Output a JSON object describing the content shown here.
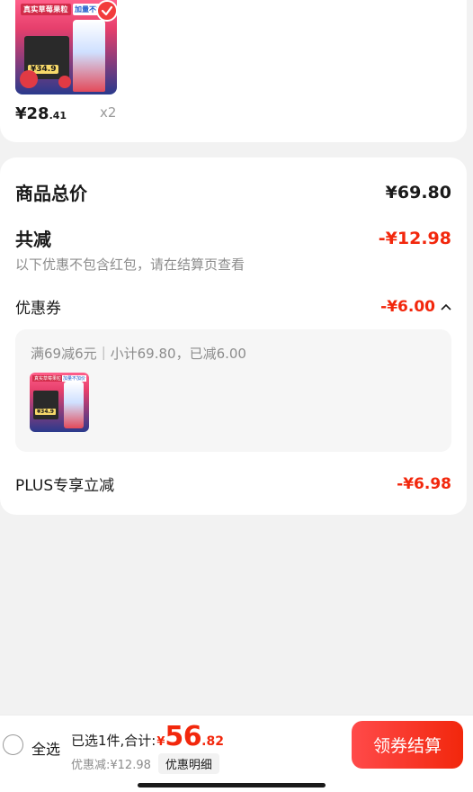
{
  "product": {
    "image_tag_left": "真实草莓果粒",
    "image_tag_right": "加量不加价",
    "image_price_tag": "¥34.9",
    "price_symbol": "¥",
    "price_int": "28",
    "price_dec": ".41",
    "quantity": "x2"
  },
  "summary": {
    "goods_total_label": "商品总价",
    "goods_total_value": "¥69.80",
    "total_discount_label": "共减",
    "total_discount_value": "-¥12.98",
    "note": "以下优惠不包含红包，请在结算页查看",
    "coupon_label": "优惠券",
    "coupon_value": "-¥6.00",
    "coupon_desc": "满69减6元｜小计69.80，已减6.00",
    "plus_label": "PLUS专享立减",
    "plus_value": "-¥6.98"
  },
  "bottom": {
    "select_all": "全选",
    "selected_text": "已选1件,合计:",
    "total_symbol": "¥",
    "total_int": "56",
    "total_dec": ".82",
    "discount_text": "优惠减:¥12.98",
    "detail_button": "优惠明细",
    "checkout_button": "领券结算"
  },
  "colors": {
    "accent": "#f2270c",
    "background": "#f2f2f2"
  },
  "icons": [
    "checkmark-icon",
    "chevron-up-icon",
    "radio-icon"
  ]
}
